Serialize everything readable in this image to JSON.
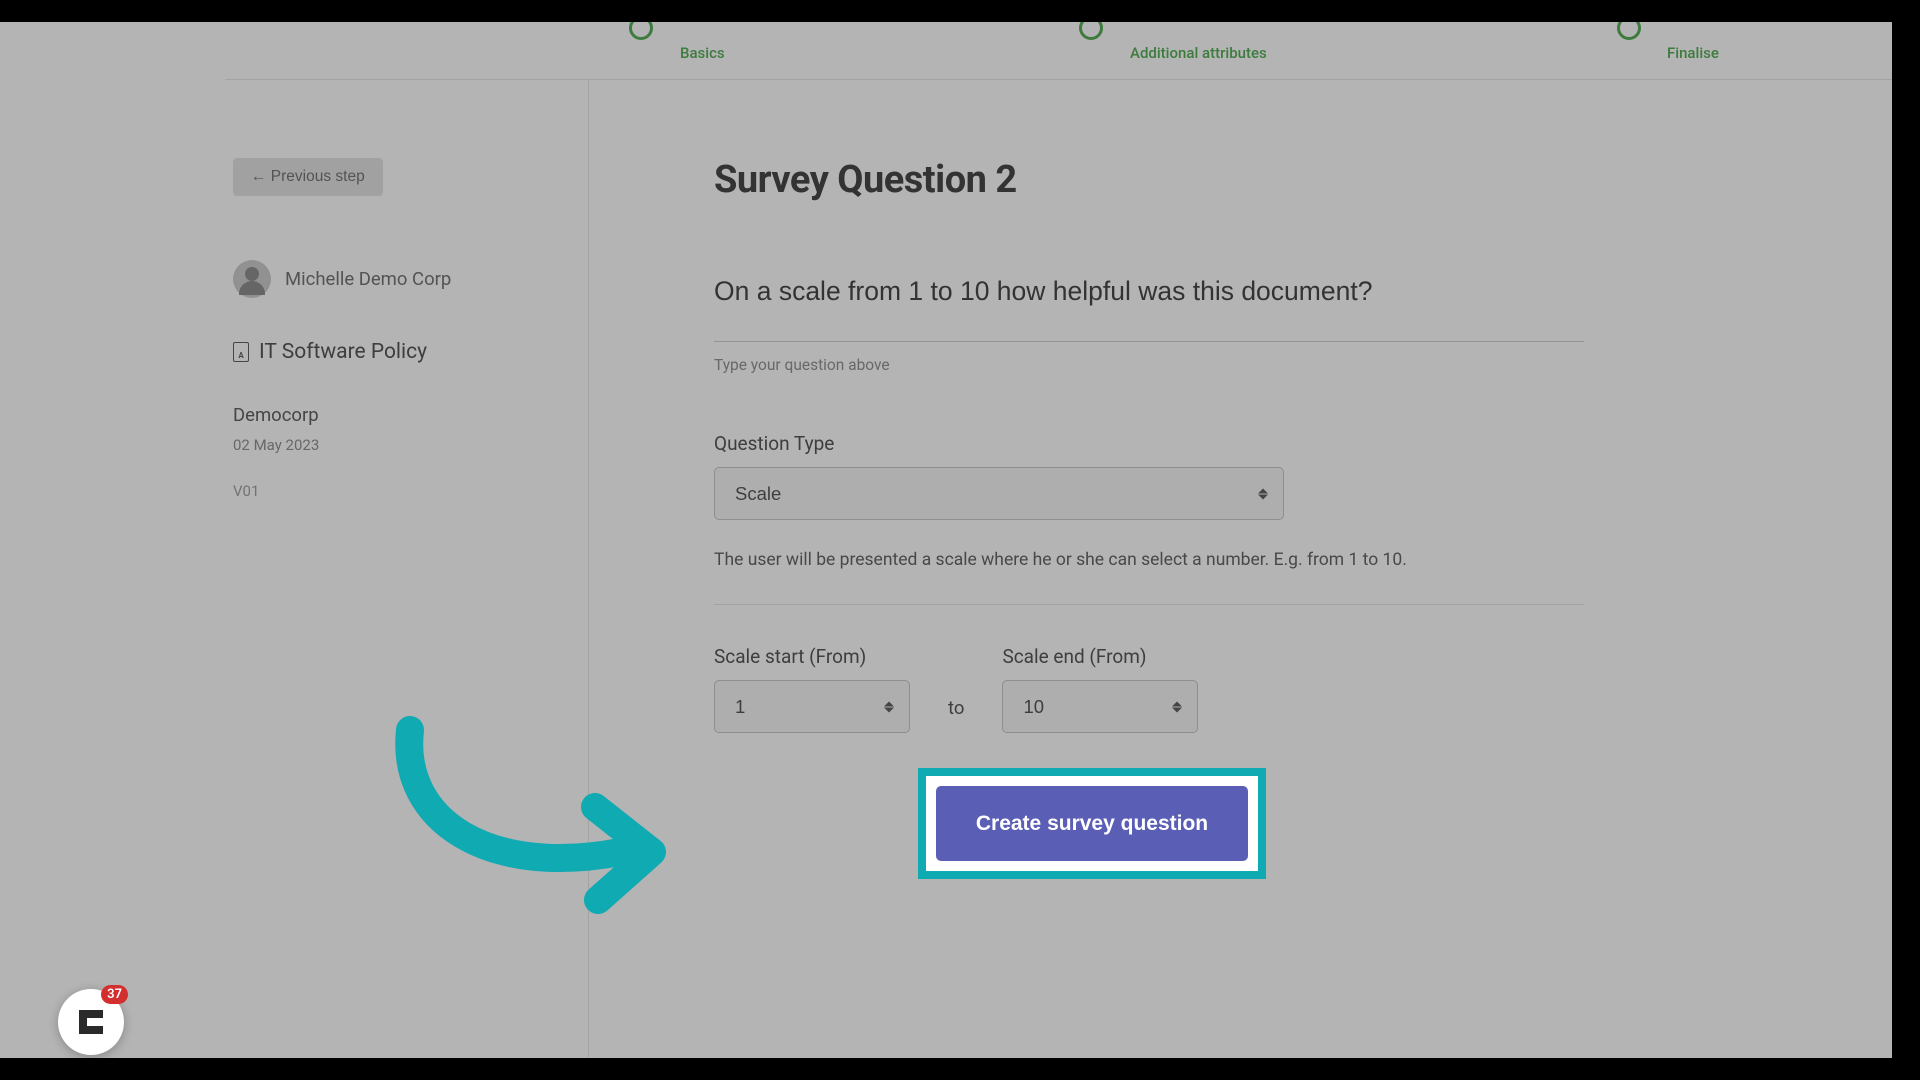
{
  "stepper": {
    "step1": "Basics",
    "step2": "Additional attributes",
    "step3": "Finalise"
  },
  "sidebar": {
    "prev_label": "← Previous step",
    "user_name": "Michelle Demo Corp",
    "doc_title": "IT Software Policy",
    "org_name": "Democorp",
    "org_date": "02 May 2023",
    "org_version": "V01"
  },
  "main": {
    "heading": "Survey Question 2",
    "question_value": "On a scale from 1 to 10 how helpful was this document?",
    "question_helper": "Type your question above",
    "type_label": "Question Type",
    "type_value": "Scale",
    "type_desc": "The user will be presented a scale where he or she can select a number. E.g. from 1 to 10.",
    "scale_start_label": "Scale start (From)",
    "scale_start_value": "1",
    "to_word": "to",
    "scale_end_label": "Scale end (From)",
    "scale_end_value": "10",
    "create_label": "Create survey question"
  },
  "widget": {
    "badge_count": "37"
  }
}
